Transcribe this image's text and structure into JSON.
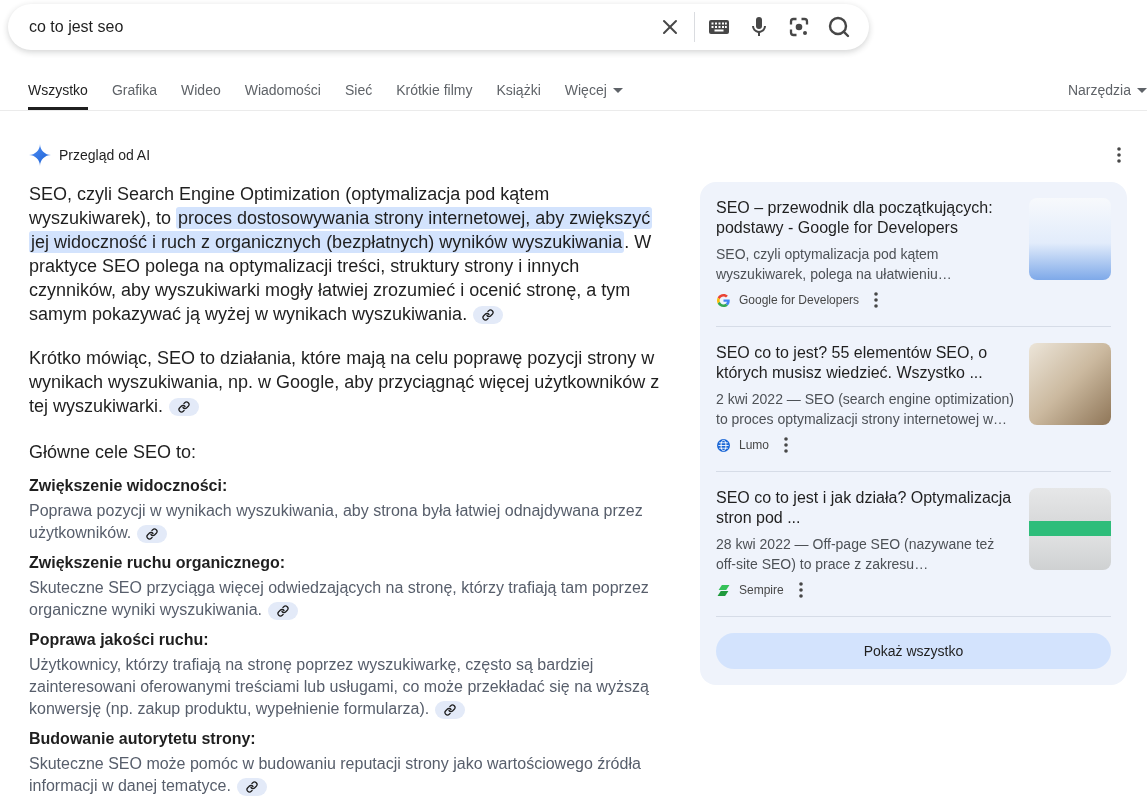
{
  "search": {
    "value": "co to jest seo"
  },
  "tabs": [
    {
      "label": "Wszystko",
      "selected": true,
      "kind": "tab"
    },
    {
      "label": "Grafika",
      "selected": false,
      "kind": "tab"
    },
    {
      "label": "Wideo",
      "selected": false,
      "kind": "tab"
    },
    {
      "label": "Wiadomości",
      "selected": false,
      "kind": "tab"
    },
    {
      "label": "Sieć",
      "selected": false,
      "kind": "tab"
    },
    {
      "label": "Krótkie filmy",
      "selected": false,
      "kind": "tab"
    },
    {
      "label": "Książki",
      "selected": false,
      "kind": "tab"
    },
    {
      "label": "Więcej",
      "selected": false,
      "kind": "menu"
    }
  ],
  "tools": {
    "label": "Narzędzia"
  },
  "ai_overview": {
    "title": "Przegląd od AI",
    "paragraphs": [
      {
        "segments": [
          {
            "text": "SEO, czyli Search Engine Optimization (optymalizacja pod kątem wyszukiwarek), to ",
            "highlighted": false
          },
          {
            "text": "proces dostosowywania strony internetowej, aby zwiększyć jej widoczność i ruch z organicznych (bezpłatnych) wyników wyszukiwania",
            "highlighted": true
          },
          {
            "text": ". W praktyce SEO polega na optymalizacji treści, struktury strony i innych czynników, aby wyszukiwarki mogły łatwiej zrozumieć i ocenić stronę, a tym samym pokazywać ją wyżej w wynikach wyszukiwania.",
            "highlighted": false
          }
        ],
        "cited": true
      },
      {
        "segments": [
          {
            "text": "Krótko mówiąc, SEO to działania, które mają na celu poprawę pozycji strony w wynikach wyszukiwania, np. w Google, aby przyciągnąć więcej użytkowników z tej wyszukiwarki.",
            "highlighted": false
          }
        ],
        "cited": true
      }
    ],
    "list_intro": "Główne cele SEO to:",
    "goals": [
      {
        "title": "Zwiększenie widoczności:",
        "text": "Poprawa pozycji w wynikach wyszukiwania, aby strona była łatwiej odnajdywana przez użytkowników.",
        "cited": true
      },
      {
        "title": "Zwiększenie ruchu organicznego:",
        "text": "Skuteczne SEO przyciąga więcej odwiedzających na stronę, którzy trafiają tam poprzez organiczne wyniki wyszukiwania.",
        "cited": true
      },
      {
        "title": "Poprawa jakości ruchu:",
        "text": "Użytkownicy, którzy trafiają na stronę poprzez wyszukiwarkę, często są bardziej zainteresowani oferowanymi treściami lub usługami, co może przekładać się na wyższą konwersję (np. zakup produktu, wypełnienie formularza).",
        "cited": true
      },
      {
        "title": "Budowanie autorytetu strony:",
        "text": "Skuteczne SEO może pomóc w budowaniu reputacji strony jako wartościowego źródła informacji w danej tematyce.",
        "cited": true
      }
    ]
  },
  "sources": {
    "items": [
      {
        "title": "SEO – przewodnik dla początkujących: podstawy - Google for Developers",
        "snippet": "SEO, czyli optymalizacja pod kątem wyszukiwarek, polega na ułatwieniu…",
        "site": "Google for Developers",
        "kind": "g"
      },
      {
        "title": "SEO co to jest? 55 elementów SEO, o których musisz wiedzieć. Wszystko ...",
        "snippet": "2 kwi 2022 — SEO (search engine optimization) to proces optymalizacji strony internetowej w…",
        "site": "Lumo",
        "kind": "globe"
      },
      {
        "title": "SEO co to jest i jak działa? Optymalizacja stron pod ...",
        "snippet": "28 kwi 2022 — Off-page SEO (nazywane też off-site SEO) to prace z zakresu…",
        "site": "Sempire",
        "kind": "s"
      }
    ],
    "button": "Pokaż wszystko"
  }
}
